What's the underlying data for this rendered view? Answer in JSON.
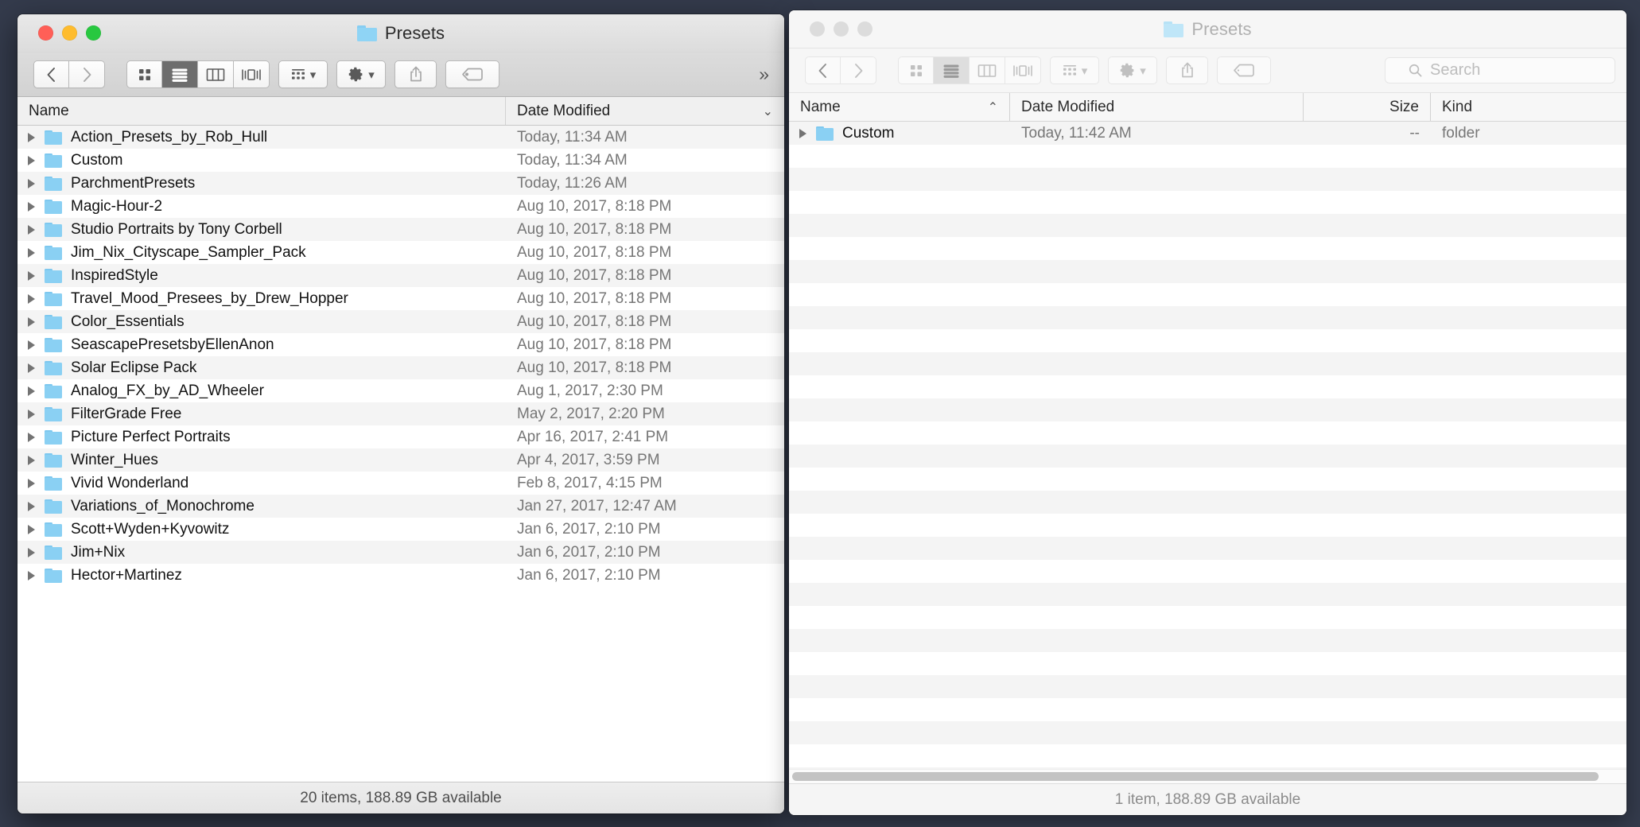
{
  "left_window": {
    "title": "Presets",
    "state": "active",
    "traffic_lights": {
      "close": "#ff5f57",
      "minimize": "#febc2e",
      "maximize": "#28c840"
    },
    "toolbar": {
      "back_label": "Back",
      "forward_label": "Forward",
      "view_icon_label": "Icon View",
      "view_list_label": "List View",
      "view_column_label": "Column View",
      "view_gallery_label": "Gallery View",
      "group_label": "Group Items",
      "action_label": "Action",
      "share_label": "Share",
      "tags_label": "Tags",
      "overflow_label": "»",
      "selected_view": "list"
    },
    "columns": [
      {
        "key": "name",
        "label": "Name",
        "sort": ""
      },
      {
        "key": "date",
        "label": "Date Modified",
        "sort": "⌄"
      }
    ],
    "rows": [
      {
        "name": "Action_Presets_by_Rob_Hull",
        "date": "Today, 11:34 AM"
      },
      {
        "name": "Custom",
        "date": "Today, 11:34 AM"
      },
      {
        "name": "ParchmentPresets",
        "date": "Today, 11:26 AM"
      },
      {
        "name": "Magic-Hour-2",
        "date": "Aug 10, 2017, 8:18 PM"
      },
      {
        "name": "Studio Portraits by Tony Corbell",
        "date": "Aug 10, 2017, 8:18 PM"
      },
      {
        "name": "Jim_Nix_Cityscape_Sampler_Pack",
        "date": "Aug 10, 2017, 8:18 PM"
      },
      {
        "name": "InspiredStyle",
        "date": "Aug 10, 2017, 8:18 PM"
      },
      {
        "name": "Travel_Mood_Presees_by_Drew_Hopper",
        "date": "Aug 10, 2017, 8:18 PM"
      },
      {
        "name": "Color_Essentials",
        "date": "Aug 10, 2017, 8:18 PM"
      },
      {
        "name": "SeascapePresetsbyEllenAnon",
        "date": "Aug 10, 2017, 8:18 PM"
      },
      {
        "name": "Solar Eclipse Pack",
        "date": "Aug 10, 2017, 8:18 PM"
      },
      {
        "name": "Analog_FX_by_AD_Wheeler",
        "date": "Aug 1, 2017, 2:30 PM"
      },
      {
        "name": "FilterGrade Free",
        "date": "May 2, 2017, 2:20 PM"
      },
      {
        "name": "Picture Perfect Portraits",
        "date": "Apr 16, 2017, 2:41 PM"
      },
      {
        "name": "Winter_Hues",
        "date": "Apr 4, 2017, 3:59 PM"
      },
      {
        "name": "Vivid Wonderland",
        "date": "Feb 8, 2017, 4:15 PM"
      },
      {
        "name": "Variations_of_Monochrome",
        "date": "Jan 27, 2017, 12:47 AM"
      },
      {
        "name": "Scott+Wyden+Kyvowitz",
        "date": "Jan 6, 2017, 2:10 PM"
      },
      {
        "name": "Jim+Nix",
        "date": "Jan 6, 2017, 2:10 PM"
      },
      {
        "name": "Hector+Martinez",
        "date": "Jan 6, 2017, 2:10 PM"
      }
    ],
    "status": "20 items, 188.89 GB available"
  },
  "right_window": {
    "title": "Presets",
    "state": "inactive",
    "toolbar": {
      "back_label": "Back",
      "forward_label": "Forward",
      "view_icon_label": "Icon View",
      "view_list_label": "List View",
      "view_column_label": "Column View",
      "view_gallery_label": "Gallery View",
      "group_label": "Group Items",
      "action_label": "Action",
      "share_label": "Share",
      "tags_label": "Tags",
      "selected_view": "list"
    },
    "search": {
      "placeholder": "Search",
      "value": ""
    },
    "columns": [
      {
        "key": "name",
        "label": "Name",
        "sort": "⌃"
      },
      {
        "key": "date",
        "label": "Date Modified",
        "sort": ""
      },
      {
        "key": "size",
        "label": "Size",
        "sort": ""
      },
      {
        "key": "kind",
        "label": "Kind",
        "sort": ""
      }
    ],
    "rows": [
      {
        "name": "Custom",
        "date": "Today, 11:42 AM",
        "size": "--",
        "kind": "folder"
      }
    ],
    "status": "1 item, 188.89 GB available"
  }
}
